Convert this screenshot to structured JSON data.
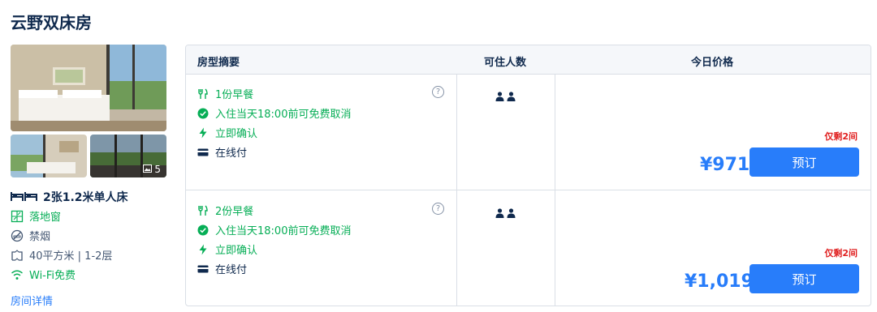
{
  "room": {
    "title": "云野双床房"
  },
  "photos": {
    "more_count": "5"
  },
  "bed": {
    "label": "2张1.2米单人床"
  },
  "features": [
    {
      "label": "落地窗",
      "icon": "window-icon"
    },
    {
      "label": "禁烟",
      "icon": "no-smoking-icon"
    },
    {
      "label": "40平方米 | 1-2层",
      "icon": "area-icon"
    },
    {
      "label": "Wi-Fi免费",
      "icon": "wifi-icon"
    }
  ],
  "room_details_link": "房间详情",
  "table": {
    "headers": {
      "summary": "房型摘要",
      "occupancy": "可住人数",
      "price": "今日价格"
    }
  },
  "offers": [
    {
      "meal": "1份早餐",
      "cancel": "入住当天18:00前可免费取消",
      "confirm": "立即确认",
      "payment": "在线付",
      "help": "?",
      "remaining": "仅剩2间",
      "price": "¥971",
      "book": "预订"
    },
    {
      "meal": "2份早餐",
      "cancel": "入住当天18:00前可免费取消",
      "confirm": "立即确认",
      "payment": "在线付",
      "help": "?",
      "remaining": "仅剩2间",
      "price": "¥1,019",
      "book": "预订"
    }
  ],
  "colors": {
    "accent": "#287dfa",
    "green": "#06ae56",
    "red": "#e02020",
    "text": "#0f294d"
  }
}
